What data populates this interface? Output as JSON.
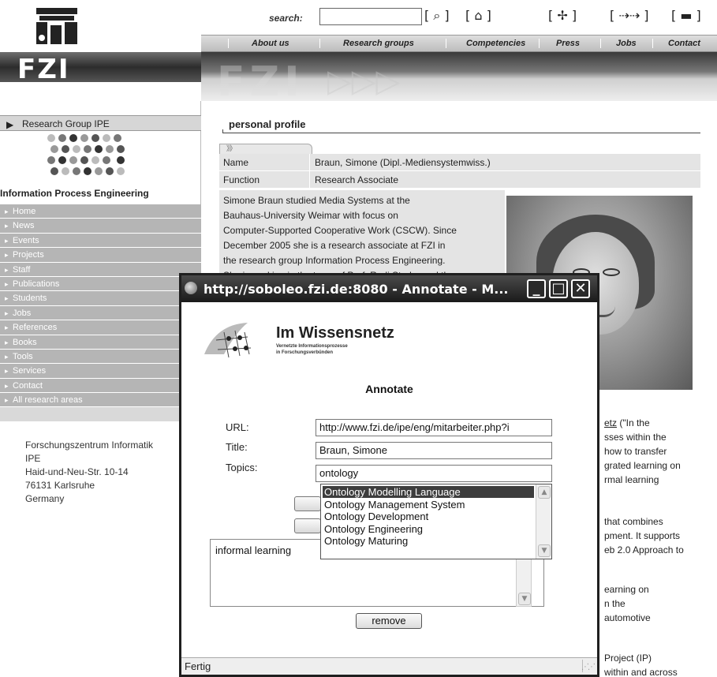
{
  "header": {
    "logo_text": "FZI",
    "search_label": "search:",
    "search_value": "",
    "search_button_glyph": "[ ⌕ ]",
    "toolbar": [
      {
        "name": "home-icon",
        "glyph": "[ ⌂ ]"
      },
      {
        "name": "sitemap-icon",
        "glyph": "[ ✢ ]"
      },
      {
        "name": "navigate-icon",
        "glyph": "[ ⇢⇢ ]"
      },
      {
        "name": "print-icon",
        "glyph": "[ ▬ ]"
      }
    ],
    "nav": [
      "About us",
      "Research groups",
      "Competencies",
      "Press",
      "Jobs",
      "Contact"
    ],
    "banner_text": "FZI"
  },
  "sidebar": {
    "group_label": "Research Group IPE",
    "title": "Information Process Engineering",
    "menu": [
      "Home",
      "News",
      "Events",
      "Projects",
      "Staff",
      "Publications",
      "Students",
      "Jobs",
      "References",
      "Books",
      "Tools",
      "Services",
      "Contact",
      "All research areas"
    ],
    "address": [
      "Forschungszentrum Informatik",
      "IPE",
      "Haid-und-Neu-Str. 10-14",
      "76131 Karlsruhe",
      "Germany"
    ]
  },
  "profile": {
    "title": "personal profile",
    "tab_glyph": "》》",
    "rows": [
      {
        "key": "Name",
        "value": "Braun, Simone (Dipl.-Mediensystemwiss.)"
      },
      {
        "key": "Function",
        "value": "Research Associate"
      }
    ],
    "bio_lines": [
      "Simone Braun studied Media Systems at the",
      "Bauhaus-University Weimar with focus on",
      "Computer-Supported Cooperative Work (CSCW). Since",
      "December 2005 she is a research associate at FZI in",
      "the research group Information Process Engineering.",
      "She is working in the team of Prof. Rudi Studer and the"
    ],
    "right_block_1": [
      {
        "text": "etz",
        "link": true,
        "tail": " (\"In the"
      },
      {
        "text": "sses within the"
      },
      {
        "text": "how to transfer"
      },
      {
        "text": "grated learning on"
      },
      {
        "text": "rmal learning"
      }
    ],
    "right_block_2": [
      {
        "text": " that combines"
      },
      {
        "text": "pment. It supports"
      },
      {
        "text": "eb 2.0 Approach to",
        "link": true
      }
    ],
    "right_block_3": [
      {
        "text": "earning on"
      },
      {
        "text": "n the"
      },
      {
        "text": " automotive"
      }
    ],
    "right_block_4": [
      {
        "text": "Project (IP)"
      },
      {
        "text": "within and across"
      }
    ]
  },
  "popup": {
    "title": "http://soboleo.fzi.de:8080 - Annotate - M...",
    "buttons": {
      "minimize": "_",
      "maximize": "□",
      "close": "✕"
    },
    "logo_name": "Im Wissensnetz",
    "logo_sub_1": "Vernetzte Informationsprozesse",
    "logo_sub_2": "in Forschungsverbünden",
    "heading": "Annotate",
    "labels": {
      "url": "URL:",
      "title": "Title:",
      "topics": "Topics:"
    },
    "values": {
      "url": "http://www.fzi.de/ipe/eng/mitarbeiter.php?i",
      "title": "Braun, Simone",
      "topics": "ontology"
    },
    "suggestions": [
      "Ontology Modelling Language",
      "Ontology Management System",
      "Ontology Development",
      "Ontology Engineering",
      "Ontology Maturing"
    ],
    "selected_suggestion": "Ontology Modelling Language",
    "textarea_value": "informal learning",
    "remove_label": "remove",
    "status": "Fertig"
  }
}
